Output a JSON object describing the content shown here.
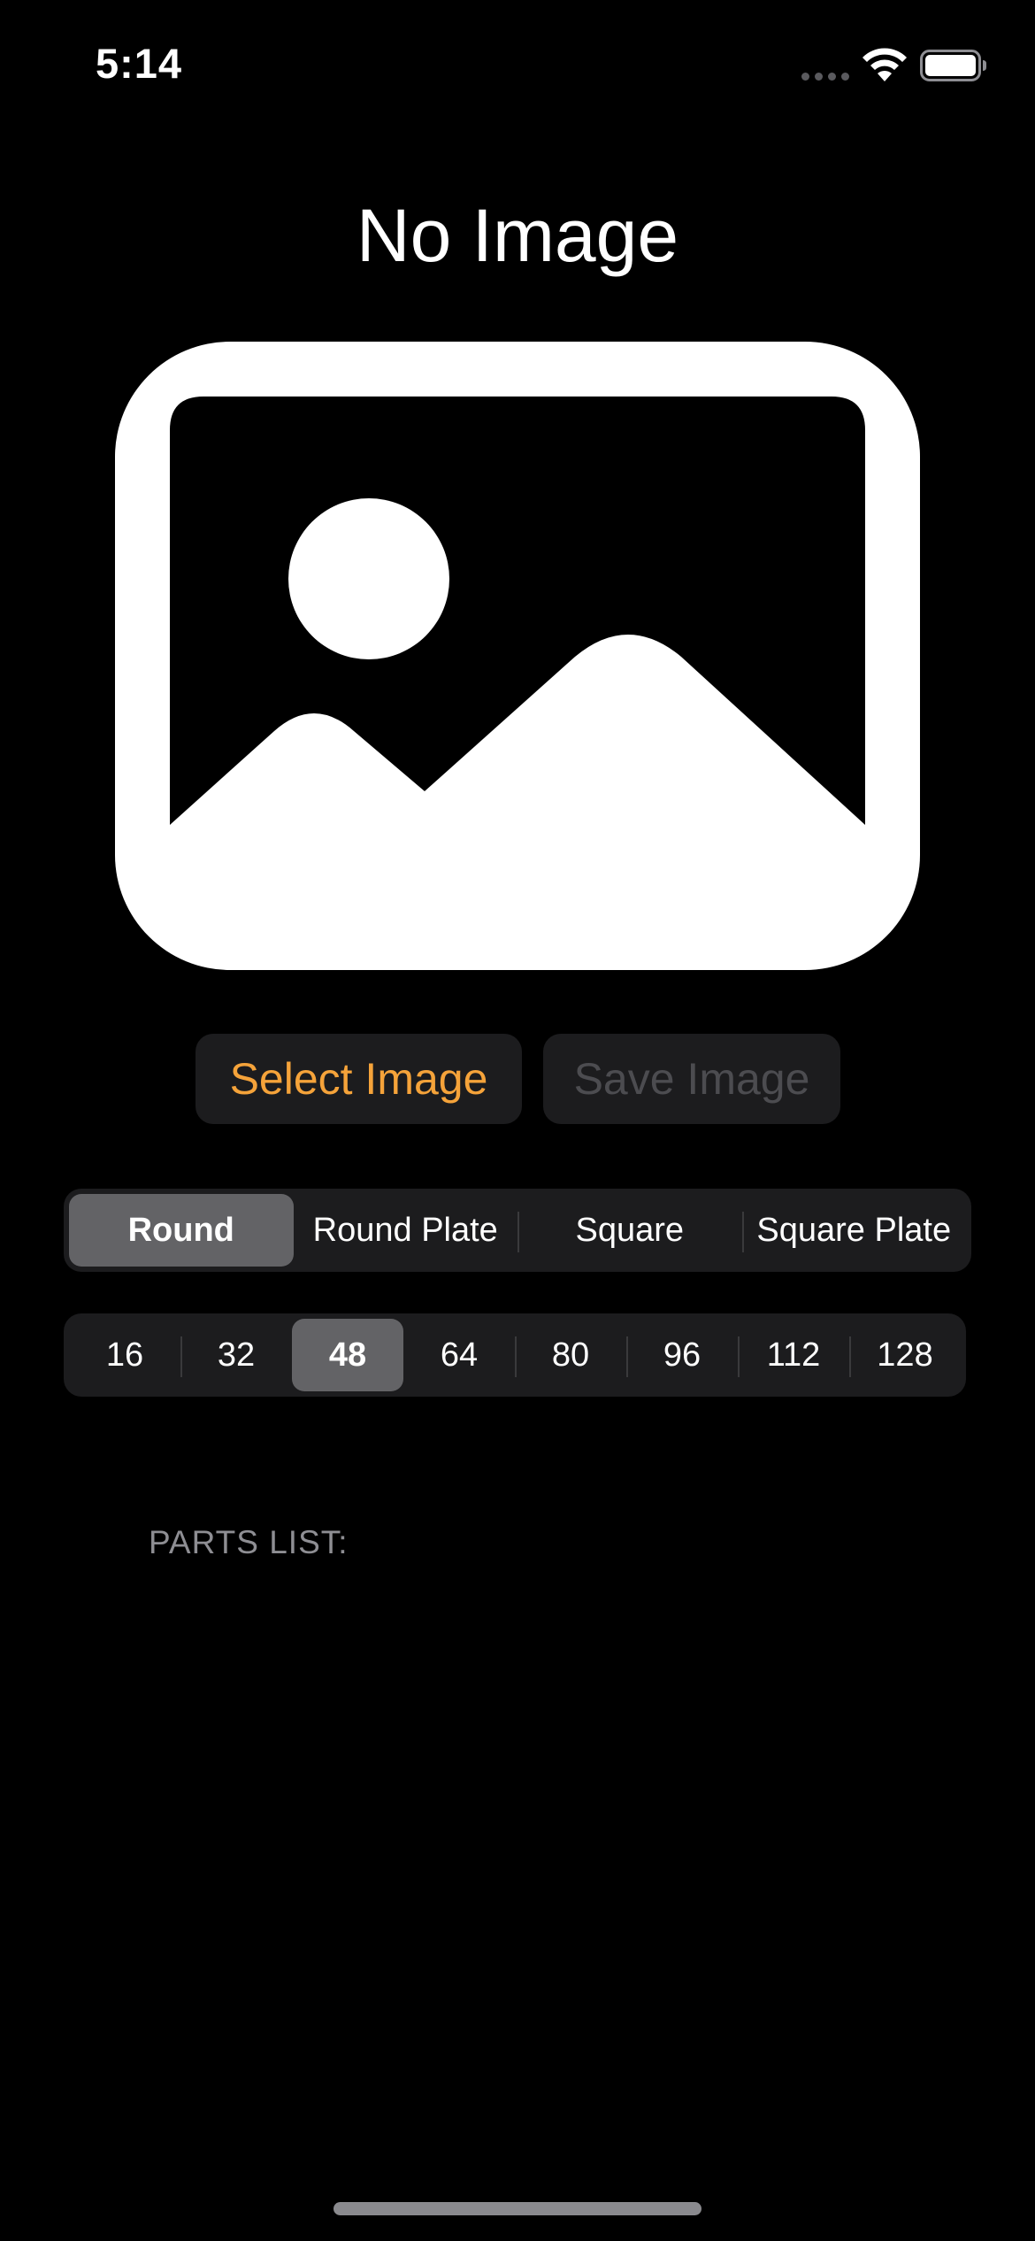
{
  "status_bar": {
    "time": "5:14",
    "icons": [
      "signal-dots-icon",
      "wifi-icon",
      "battery-icon"
    ]
  },
  "title": "No Image",
  "placeholder_icon": "photo-placeholder-icon",
  "buttons": {
    "select_label": "Select Image",
    "save_label": "Save Image",
    "select_color": "#f5a33a",
    "save_state": "disabled"
  },
  "shape_segments": {
    "items": [
      "Round",
      "Round Plate",
      "Square",
      "Square Plate"
    ],
    "selected": "Round"
  },
  "size_segments": {
    "items": [
      "16",
      "32",
      "48",
      "64",
      "80",
      "96",
      "112",
      "128"
    ],
    "selected": "48"
  },
  "parts_list_label": "PARTS LIST:"
}
